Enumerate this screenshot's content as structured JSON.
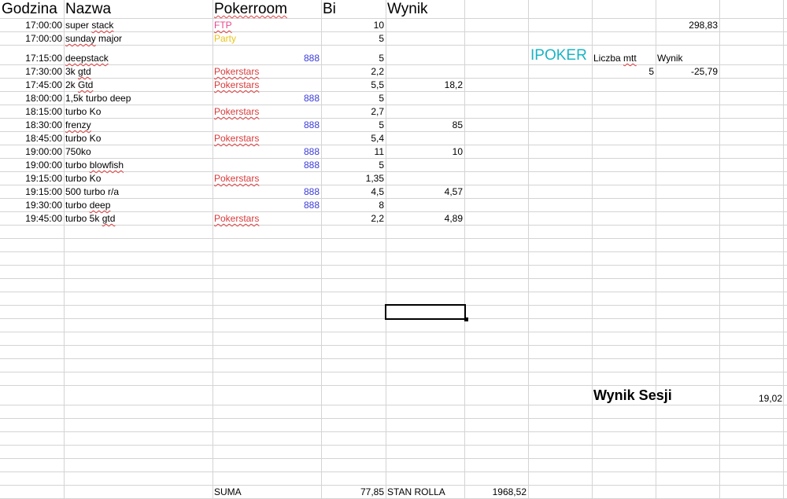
{
  "headers": {
    "godzina": "Godzina",
    "nazwa": "Nazwa",
    "pokerroom": "Pokerroom",
    "bi": "Bi",
    "wynik": "Wynik"
  },
  "tournaments": [
    {
      "time": "17:00:00",
      "name": "super stack",
      "room": "FTP",
      "bi": "10",
      "result": ""
    },
    {
      "time": "17:00:00",
      "name": "sunday major",
      "room": "Party",
      "bi": "5",
      "result": ""
    },
    {
      "time": "17:15:00",
      "name": "deepstack",
      "room": "888",
      "bi": "5",
      "result": ""
    },
    {
      "time": "17:30:00",
      "name": "3k gtd",
      "room": "Pokerstars",
      "bi": "2,2",
      "result": ""
    },
    {
      "time": "17:45:00",
      "name": "2k Gtd",
      "room": "Pokerstars",
      "bi": "5,5",
      "result": "18,2"
    },
    {
      "time": "18:00:00",
      "name": "1,5k turbo deep",
      "room": "888",
      "bi": "5",
      "result": ""
    },
    {
      "time": "18:15:00",
      "name": "turbo Ko",
      "room": "Pokerstars",
      "bi": "2,7",
      "result": ""
    },
    {
      "time": "18:30:00",
      "name": "frenzy",
      "room": "888",
      "bi": "5",
      "result": "85"
    },
    {
      "time": "18:45:00",
      "name": "turbo Ko",
      "room": "Pokerstars",
      "bi": "5,4",
      "result": ""
    },
    {
      "time": "19:00:00",
      "name": "750ko",
      "room": "888",
      "bi": "11",
      "result": "10"
    },
    {
      "time": "19:00:00",
      "name": "turbo blowfish",
      "room": "888",
      "bi": "5",
      "result": ""
    },
    {
      "time": "19:15:00",
      "name": "turbo Ko",
      "room": "Pokerstars",
      "bi": "1,35",
      "result": ""
    },
    {
      "time": "19:15:00",
      "name": "500 turbo r/a",
      "room": "888",
      "bi": "4,5",
      "result": "4,57"
    },
    {
      "time": "19:30:00",
      "name": "turbo deep",
      "room": "888",
      "bi": "8",
      "result": ""
    },
    {
      "time": "19:45:00",
      "name": "turbo 5k gtd",
      "room": "Pokerstars",
      "bi": "2,2",
      "result": "4,89"
    }
  ],
  "top_right_value": "298,83",
  "ipoker": {
    "label": "IPOKER",
    "count_label": "Liczba mtt",
    "result_label": "Wynik",
    "count": "5",
    "result": "-25,79"
  },
  "session": {
    "label": "Wynik Sesji",
    "value": "19,02"
  },
  "footer": {
    "suma_label": "SUMA",
    "suma_value": "77,85",
    "stan_label": "STAN ROLLA",
    "stan_value": "1968,52"
  },
  "colors": {
    "ftp": "#e8468c",
    "party": "#e8c51a",
    "pokerstars": "#d93a3a",
    "888": "#3b3bd9",
    "ipoker": "#19b4c4",
    "gridline": "#d4d4d4"
  }
}
